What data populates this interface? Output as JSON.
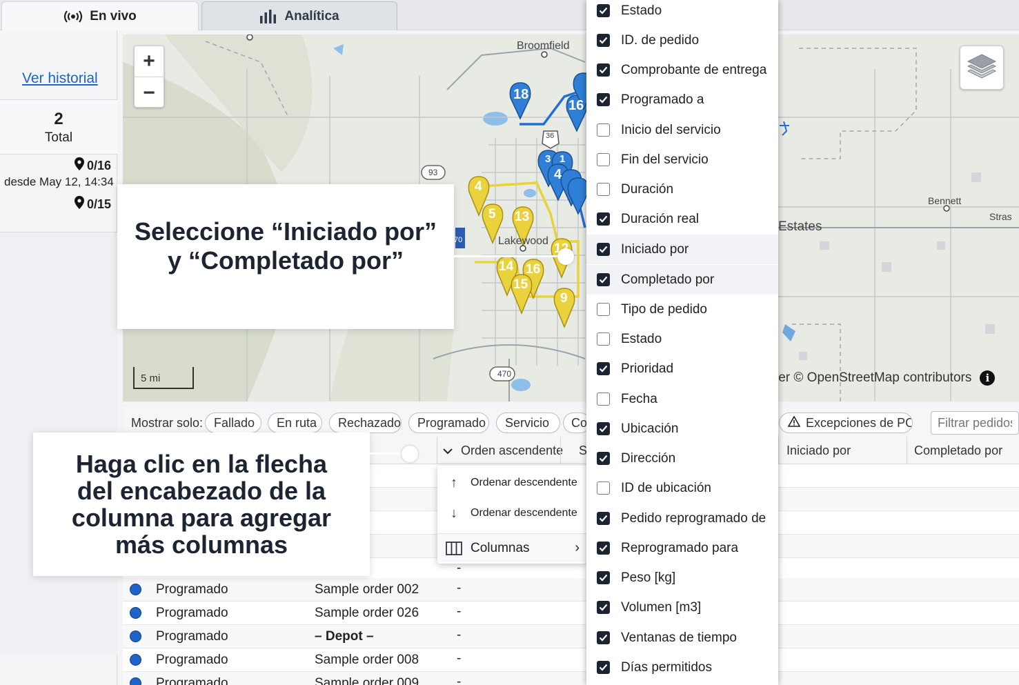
{
  "tabs": [
    {
      "label": "En vivo",
      "icon": "broadcast-icon",
      "active": true
    },
    {
      "label": "Analítica",
      "icon": "bar-chart-icon",
      "active": false
    }
  ],
  "sidebar": {
    "history_link": "Ver historial",
    "total_count": "2",
    "total_label": "Total",
    "progress_1": "0/16",
    "since": "desde May 12, 14:34",
    "progress_2": "0/15"
  },
  "map": {
    "zoom_in": "+",
    "zoom_out": "−",
    "scale_label": "5 mi",
    "place_labels": {
      "broomfield": "Broomfield",
      "lakewood": "Lakewood",
      "bennett": "Bennett",
      "estates": "Estates",
      "stras": "Stras",
      "hw93": "93",
      "hw470": "470",
      "hw70": "70",
      "hw36": "36"
    },
    "attribution": "ler © OpenStreetMap contributors",
    "blue_markers": [
      "18",
      "16",
      "3",
      "1",
      "4"
    ],
    "yellow_markers": [
      "4",
      "5",
      "13",
      "14",
      "16",
      "15",
      "9",
      "12"
    ],
    "colors": {
      "blue_route": "#1f6fd6",
      "yellow_route": "#e9d23c",
      "road": "#b8bcc4"
    }
  },
  "filters": {
    "label": "Mostrar solo:",
    "chips": [
      "Fallado",
      "En ruta",
      "Rechazado",
      "Programado",
      "Servicio",
      "Co",
      "Excepciones de POD"
    ],
    "search_placeholder": "Filtrar pedidos.."
  },
  "table": {
    "headers": {
      "sort_column": "Orden ascendente",
      "col_s": "S",
      "started_by": "Iniciado por",
      "completed_by": "Completado por"
    },
    "rows": [
      {
        "status": "Programado",
        "order": "Sample order 002",
        "value": "-",
        "bold": false
      },
      {
        "status": "Programado",
        "order": "Sample order 026",
        "value": "-",
        "bold": false
      },
      {
        "status": "Programado",
        "order": "– Depot –",
        "value": "-",
        "bold": true
      },
      {
        "status": "Programado",
        "order": "Sample order 008",
        "value": "-",
        "bold": false
      },
      {
        "status": "Programado",
        "order": "Sample order 009",
        "value": "-",
        "bold": false
      }
    ],
    "partial_dash": "-"
  },
  "sort_menu": {
    "item1": "Ordenar descendente",
    "item2": "Ordenar descendente",
    "columns": "Columnas"
  },
  "columns_panel": [
    {
      "label": "Estado",
      "checked": true
    },
    {
      "label": "ID. de pedido",
      "checked": true
    },
    {
      "label": "Comprobante de entrega",
      "checked": true
    },
    {
      "label": "Programado a",
      "checked": true
    },
    {
      "label": "Inicio del servicio",
      "checked": false
    },
    {
      "label": "Fin del servicio",
      "checked": false
    },
    {
      "label": "Duración",
      "checked": false
    },
    {
      "label": "Duración real",
      "checked": true
    },
    {
      "label": "Iniciado por",
      "checked": true
    },
    {
      "label": "Completado por",
      "checked": true
    },
    {
      "label": "Tipo de pedido",
      "checked": false
    },
    {
      "label": "Estado",
      "checked": false
    },
    {
      "label": "Prioridad",
      "checked": true
    },
    {
      "label": "Fecha",
      "checked": false
    },
    {
      "label": "Ubicación",
      "checked": true
    },
    {
      "label": "Dirección",
      "checked": true
    },
    {
      "label": "ID de ubicación",
      "checked": false
    },
    {
      "label": "Pedido reprogramado de",
      "checked": true
    },
    {
      "label": "Reprogramado para",
      "checked": true
    },
    {
      "label": "Peso [kg]",
      "checked": true
    },
    {
      "label": "Volumen [m3]",
      "checked": true
    },
    {
      "label": "Ventanas de tiempo",
      "checked": true
    },
    {
      "label": "Días permitidos",
      "checked": true
    }
  ],
  "callouts": {
    "c1_line1": "Seleccione “Iniciado por”",
    "c1_line2": "y “Completado por”",
    "c2_line1": "Haga clic en la flecha",
    "c2_line2": "del encabezado de la",
    "c2_line3": "columna para agregar",
    "c2_line4": "más columnas"
  }
}
